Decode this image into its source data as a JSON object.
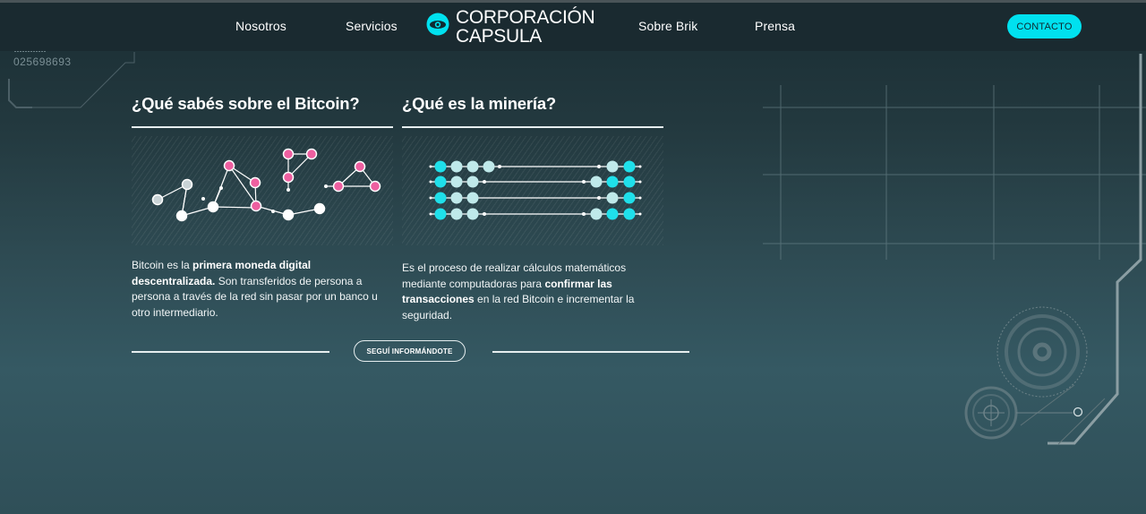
{
  "header": {
    "nav": [
      {
        "label": "Nosotros"
      },
      {
        "label": "Servicios"
      },
      {
        "label": "Sobre Brik"
      },
      {
        "label": "Prensa"
      }
    ],
    "logo": {
      "line1": "CORPORACIÓN",
      "line2": "CAPSULA",
      "icon": "eye-icon"
    },
    "contact_label": "CONTACTO"
  },
  "decor": {
    "number": "025698693"
  },
  "bitcoin": {
    "title": "¿Qué sabés sobre el Bitcoin?",
    "illustration": "network-graph-icon",
    "text_pre": "Bitcoin es la ",
    "text_bold1": "primera moneda digital descentralizada.",
    "text_post": " Son transferidos de persona a persona a través de la red sin pasar por un banco u otro intermediario."
  },
  "mining": {
    "title": "¿Qué es la minería?",
    "illustration": "mining-blocks-icon",
    "text_pre": "Es el proceso de realizar cálculos matemáticos mediante computadoras para ",
    "text_bold1": "confirmar las transacciones",
    "text_post": " en la red Bitcoin e incrementar la seguridad."
  },
  "more_label": "SEGUÍ INFORMÁNDOTE",
  "colors": {
    "accent": "#00e1ef",
    "pink": "#ee5fa0",
    "header_bg": "#1a2a30",
    "bg_top": "#1a2d33",
    "bg_mid": "#355963"
  }
}
